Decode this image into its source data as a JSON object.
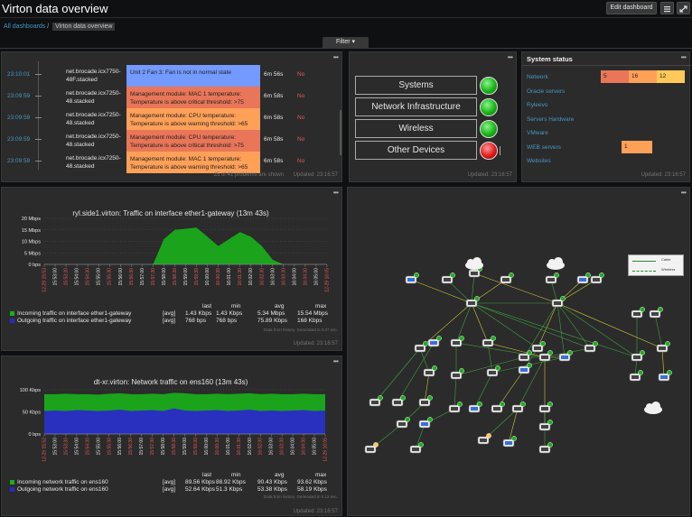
{
  "header": {
    "title": "Virton data overview",
    "edit_label": "Edit dashboard"
  },
  "breadcrumb": {
    "all": "All dashboards",
    "sep": "/",
    "current": "Virton data overview"
  },
  "filter": {
    "label": "Filter ▾"
  },
  "problems": {
    "rows": [
      {
        "time": "23:10:01",
        "host": "net.brocade.icx7750-48F.stacked",
        "problem": "Unit 2 Fan 3: Fan is not in normal state",
        "color": "#7499ff",
        "duration": "6m 56s",
        "ack": "No"
      },
      {
        "time": "23:09:59",
        "host": "net.brocade.icx7250-48.stacked",
        "problem": "Management module: MAC 1 temperature: Temperature is above critical threshold: >75",
        "color": "#e97659",
        "duration": "6m 58s",
        "ack": "No"
      },
      {
        "time": "23:09:59",
        "host": "net.brocade.icx7250-48.stacked",
        "problem": "Management module: CPU temperature: Temperature is above warning threshold: >65",
        "color": "#ffa059",
        "duration": "6m 58s",
        "ack": "No"
      },
      {
        "time": "23:09:59",
        "host": "net.brocade.icx7250-48.stacked",
        "problem": "Management module: CPU temperature: Temperature is above critical threshold: >75",
        "color": "#e97659",
        "duration": "6m 58s",
        "ack": "No"
      },
      {
        "time": "23:09:59",
        "host": "net.brocade.icx7250-48.stacked",
        "problem": "Management module: MAC 1 temperature: Temperature is above warning threshold: >65",
        "color": "#ffa059",
        "duration": "6m 58s",
        "ack": "No"
      }
    ],
    "footer": "25 of 41 problems are shown",
    "updated": "Updated: 23:16:57"
  },
  "systems": {
    "items": [
      {
        "label": "Systems",
        "status": "ok"
      },
      {
        "label": "Network Infrastructure",
        "status": "ok"
      },
      {
        "label": "Wireless",
        "status": "ok"
      },
      {
        "label": "Other Devices",
        "status": "problem"
      }
    ],
    "updated": "Updated: 23:16:57"
  },
  "system_status": {
    "title": "System status",
    "rows": [
      "Network",
      "Oracle servers",
      "Ryleevo",
      "Servers Hardware",
      "VMware",
      "WEB servers",
      "Websites"
    ],
    "network_counts": [
      "5",
      "16",
      "12"
    ],
    "web_count": "1",
    "updated": "Updated: 23:16:57"
  },
  "graph1": {
    "title": "ryl.side1.virton: Traffic on interface ether1-gateway (13m 43s)",
    "legend_header": [
      "last",
      "min",
      "avg",
      "max"
    ],
    "series": [
      {
        "name": "Incoming traffic on interface ether1-gateway",
        "fn": "[avg]",
        "last": "1.43 Kbps",
        "min": "1.43 Kbps",
        "avg": "5.34 Mbps",
        "max": "15.54 Mbps",
        "color": "#1ab01a"
      },
      {
        "name": "Outgoing traffic on interface ether1-gateway",
        "fn": "[avg]",
        "last": "768 bps",
        "min": "768 bps",
        "avg": "75.89 Kbps",
        "max": "168 Kbps",
        "color": "#2a2ac8"
      }
    ],
    "note": "Data from history. Generated in 0.07 sec.",
    "updated": "Updated: 23:16:57"
  },
  "graph2": {
    "title": "dt-xr.virton: Network traffic on ens160 (13m 43s)",
    "legend_header": [
      "last",
      "min",
      "avg",
      "max"
    ],
    "series": [
      {
        "name": "Incoming network traffic on ens160",
        "fn": "[avg]",
        "last": "89.56 Kbps",
        "min": "88.92 Kbps",
        "avg": "90.43 Kbps",
        "max": "93.62 Kbps",
        "color": "#1ab01a"
      },
      {
        "name": "Outgoing network traffic on ens160",
        "fn": "[avg]",
        "last": "52.64 Kbps",
        "min": "51.3 Kbps",
        "avg": "53.38 Kbps",
        "max": "58.19 Kbps",
        "color": "#2a2ac8"
      }
    ],
    "note": "Data from history. Generated in 0.12 sec.",
    "updated": "Updated: 23:16:57"
  },
  "chart_data": [
    {
      "type": "area",
      "title": "ryl.side1.virton: Traffic on interface ether1-gateway (13m 43s)",
      "y_ticks": [
        "20 Mbps",
        "15 Mbps",
        "10 Mbps",
        "5 Mbps",
        "0 bps"
      ],
      "ylim": [
        0,
        20
      ],
      "x_ticks": [
        "12-29 15:53",
        "15:53:00",
        "15:53:30",
        "15:54:00",
        "15:54:30",
        "15:55:00",
        "15:55:30",
        "15:56:00",
        "15:56:30",
        "15:57:00",
        "15:57:30",
        "15:58:00",
        "15:58:30",
        "15:59:00",
        "15:59:30",
        "16:00:00",
        "16:00:30",
        "16:01:00",
        "16:01:30",
        "16:02:00",
        "16:02:30",
        "16:03:00",
        "16:03:30",
        "16:04:00",
        "16:04:30",
        "16:05:00",
        "12-29 16:05"
      ],
      "series": [
        {
          "name": "Incoming traffic on interface ether1-gateway",
          "values": [
            0,
            0,
            0,
            0,
            0,
            0,
            0,
            0,
            0,
            0,
            0,
            11,
            15,
            15.5,
            16,
            12,
            8,
            11,
            14,
            12,
            8,
            2,
            0,
            0,
            0,
            0,
            0
          ]
        },
        {
          "name": "Outgoing traffic on interface ether1-gateway",
          "values": [
            0,
            0,
            0,
            0,
            0,
            0,
            0,
            0,
            0,
            0,
            0,
            0.1,
            0.1,
            0.1,
            0.1,
            0.1,
            0.1,
            0.1,
            0.1,
            0.1,
            0.1,
            0,
            0,
            0,
            0,
            0,
            0
          ]
        }
      ]
    },
    {
      "type": "area",
      "title": "dt-xr.virton: Network traffic on ens160 (13m 43s)",
      "y_ticks": [
        "100 Kbps",
        "50 Kbps",
        "0 bps"
      ],
      "ylim": [
        0,
        100
      ],
      "x_ticks": [
        "12-29 15:52",
        "15:53:00",
        "15:53:30",
        "15:54:00",
        "15:54:30",
        "15:55:00",
        "15:55:30",
        "15:56:00",
        "15:56:30",
        "15:57:00",
        "15:57:30",
        "15:58:00",
        "15:58:30",
        "15:59:00",
        "15:59:30",
        "16:00:00",
        "16:00:30",
        "16:01:00",
        "16:01:30",
        "16:02:00",
        "16:02:30",
        "16:03:00",
        "16:03:30",
        "16:04:00",
        "16:04:30",
        "16:05:00",
        "12-29 16:05"
      ],
      "series": [
        {
          "name": "Incoming network traffic on ens160",
          "values": [
            90,
            90,
            91,
            90,
            90,
            89,
            91,
            92,
            90,
            90,
            91,
            90,
            93,
            92,
            90,
            90,
            91,
            90,
            91,
            92,
            90,
            91,
            90,
            90,
            91,
            90,
            90
          ]
        },
        {
          "name": "Outgoing network traffic on ens160",
          "values": [
            52,
            53,
            52,
            54,
            53,
            52,
            53,
            55,
            52,
            53,
            54,
            52,
            58,
            53,
            52,
            53,
            54,
            52,
            53,
            55,
            52,
            53,
            52,
            53,
            54,
            52,
            53
          ]
        }
      ]
    }
  ],
  "map": {
    "legend": [
      "Cable",
      "Wireless"
    ]
  }
}
